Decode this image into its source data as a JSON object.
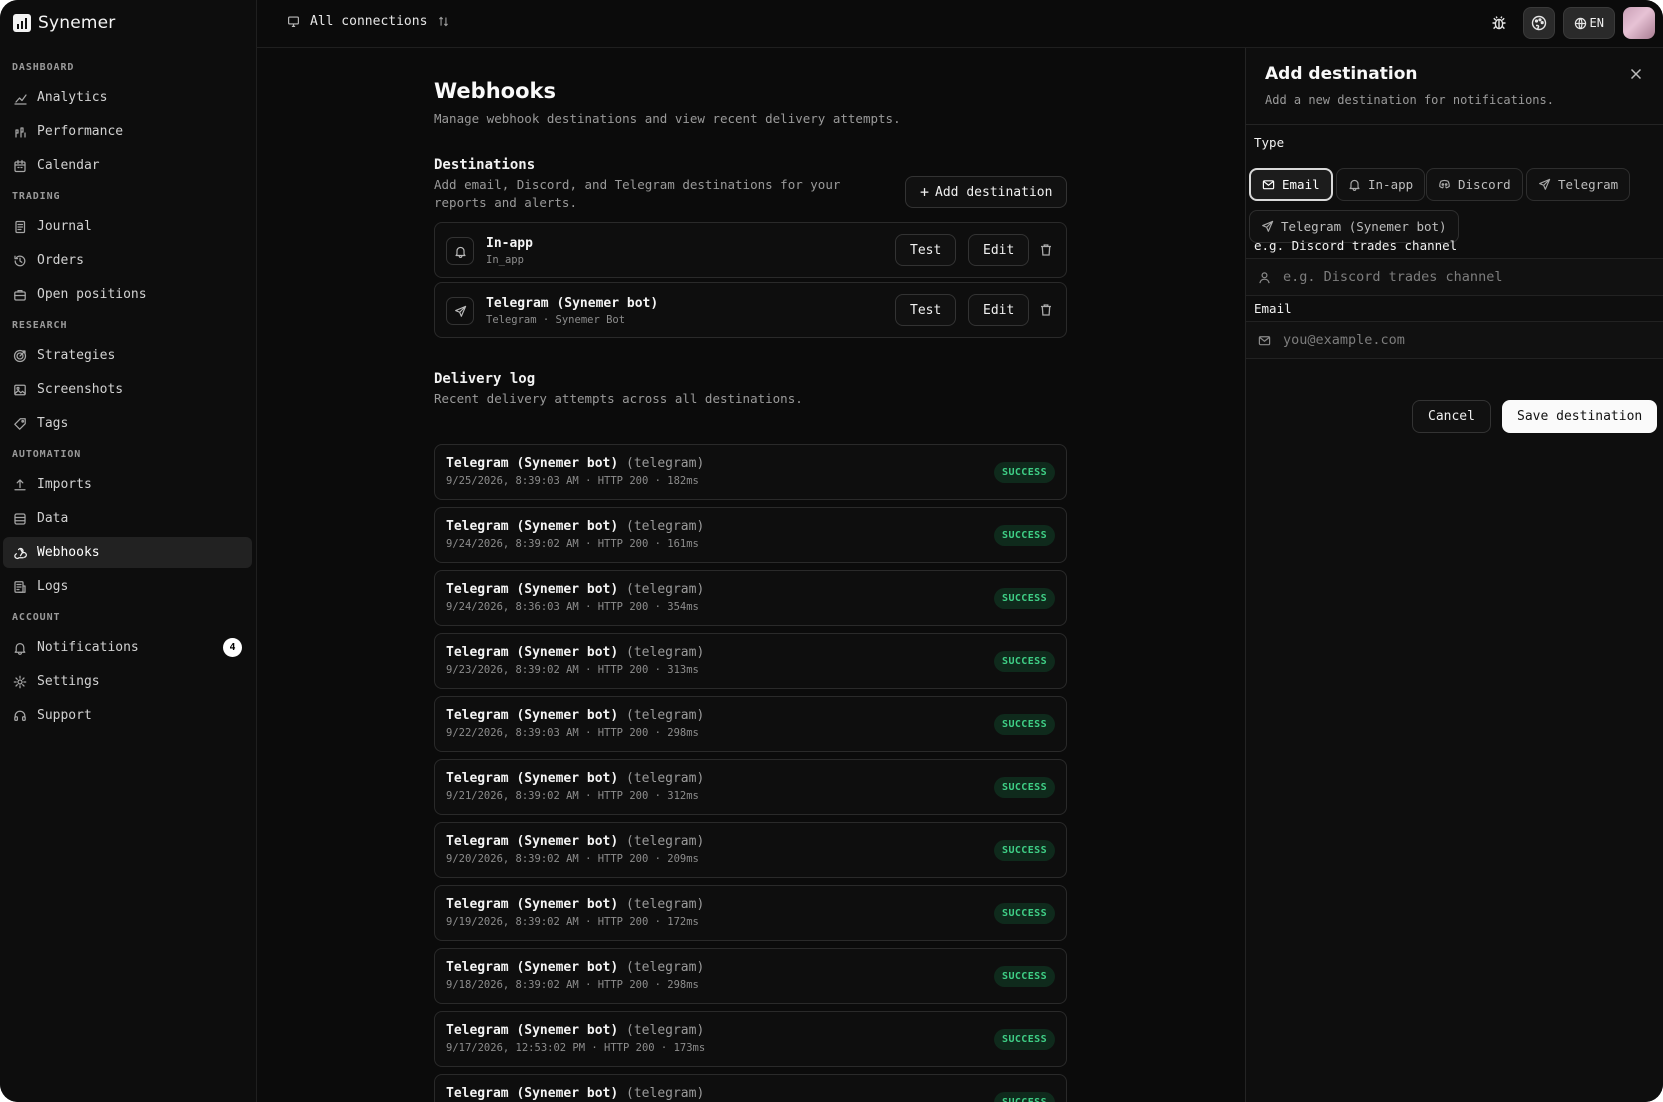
{
  "app": {
    "name": "Synemer"
  },
  "topbar": {
    "connection_label": "All connections",
    "lang": "EN"
  },
  "sidebar": {
    "sections": [
      {
        "label": "DASHBOARD",
        "items": [
          {
            "label": "Analytics",
            "icon": "chart-line-icon"
          },
          {
            "label": "Performance",
            "icon": "performance-icon"
          },
          {
            "label": "Calendar",
            "icon": "calendar-icon"
          }
        ]
      },
      {
        "label": "TRADING",
        "items": [
          {
            "label": "Journal",
            "icon": "journal-icon"
          },
          {
            "label": "Orders",
            "icon": "history-icon"
          },
          {
            "label": "Open positions",
            "icon": "briefcase-icon"
          }
        ]
      },
      {
        "label": "RESEARCH",
        "items": [
          {
            "label": "Strategies",
            "icon": "target-icon"
          },
          {
            "label": "Screenshots",
            "icon": "image-icon"
          },
          {
            "label": "Tags",
            "icon": "tag-icon"
          }
        ]
      },
      {
        "label": "AUTOMATION",
        "items": [
          {
            "label": "Imports",
            "icon": "upload-icon"
          },
          {
            "label": "Data",
            "icon": "database-icon"
          },
          {
            "label": "Webhooks",
            "icon": "webhook-icon",
            "active": true
          },
          {
            "label": "Logs",
            "icon": "logs-icon"
          }
        ]
      },
      {
        "label": "ACCOUNT",
        "items": [
          {
            "label": "Notifications",
            "icon": "bell-icon",
            "badge": "4"
          },
          {
            "label": "Settings",
            "icon": "gear-icon"
          },
          {
            "label": "Support",
            "icon": "headset-icon"
          }
        ]
      }
    ]
  },
  "main": {
    "title": "Webhooks",
    "subtitle": "Manage webhook destinations and view recent delivery attempts.",
    "destinations": {
      "title": "Destinations",
      "subtitle": "Add email, Discord, and Telegram destinations for your reports and alerts.",
      "add_label": "Add destination",
      "items": [
        {
          "name": "In-app",
          "meta": "In_app",
          "icon": "bell-icon",
          "test_label": "Test",
          "edit_label": "Edit"
        },
        {
          "name": "Telegram (Synemer bot)",
          "meta": "Telegram · Synemer Bot",
          "icon": "send-icon",
          "test_label": "Test",
          "edit_label": "Edit"
        }
      ]
    },
    "delivery_log": {
      "title": "Delivery log",
      "subtitle": "Recent delivery attempts across all destinations.",
      "rows": [
        {
          "name": "Telegram (Synemer bot)",
          "channel": "(telegram)",
          "meta": "9/25/2026, 8:39:03 AM · HTTP 200 · 182ms",
          "status": "SUCCESS"
        },
        {
          "name": "Telegram (Synemer bot)",
          "channel": "(telegram)",
          "meta": "9/24/2026, 8:39:02 AM · HTTP 200 · 161ms",
          "status": "SUCCESS"
        },
        {
          "name": "Telegram (Synemer bot)",
          "channel": "(telegram)",
          "meta": "9/24/2026, 8:36:03 AM · HTTP 200 · 354ms",
          "status": "SUCCESS"
        },
        {
          "name": "Telegram (Synemer bot)",
          "channel": "(telegram)",
          "meta": "9/23/2026, 8:39:02 AM · HTTP 200 · 313ms",
          "status": "SUCCESS"
        },
        {
          "name": "Telegram (Synemer bot)",
          "channel": "(telegram)",
          "meta": "9/22/2026, 8:39:03 AM · HTTP 200 · 298ms",
          "status": "SUCCESS"
        },
        {
          "name": "Telegram (Synemer bot)",
          "channel": "(telegram)",
          "meta": "9/21/2026, 8:39:02 AM · HTTP 200 · 312ms",
          "status": "SUCCESS"
        },
        {
          "name": "Telegram (Synemer bot)",
          "channel": "(telegram)",
          "meta": "9/20/2026, 8:39:02 AM · HTTP 200 · 209ms",
          "status": "SUCCESS"
        },
        {
          "name": "Telegram (Synemer bot)",
          "channel": "(telegram)",
          "meta": "9/19/2026, 8:39:02 AM · HTTP 200 · 172ms",
          "status": "SUCCESS"
        },
        {
          "name": "Telegram (Synemer bot)",
          "channel": "(telegram)",
          "meta": "9/18/2026, 8:39:02 AM · HTTP 200 · 298ms",
          "status": "SUCCESS"
        },
        {
          "name": "Telegram (Synemer bot)",
          "channel": "(telegram)",
          "meta": "9/17/2026, 12:53:02 PM · HTTP 200 · 173ms",
          "status": "SUCCESS"
        },
        {
          "name": "Telegram (Synemer bot)",
          "channel": "(telegram)",
          "meta": "",
          "status": "SUCCESS"
        }
      ]
    }
  },
  "drawer": {
    "title": "Add destination",
    "subtitle": "Add a new destination for notifications.",
    "type_label": "Type",
    "types": [
      {
        "label": "Email",
        "icon": "mail-icon",
        "selected": true
      },
      {
        "label": "In-app",
        "icon": "bell-icon"
      },
      {
        "label": "Discord",
        "icon": "discord-icon"
      },
      {
        "label": "Telegram",
        "icon": "send-icon"
      },
      {
        "label": "Telegram (Synemer bot)",
        "icon": "send-icon"
      }
    ],
    "name_label": "e.g. Discord trades channel",
    "name_placeholder": "e.g. Discord trades channel",
    "email_label": "Email",
    "email_placeholder": "you@example.com",
    "cancel_label": "Cancel",
    "save_label": "Save destination"
  },
  "colors": {
    "background": "#0b0b0b",
    "success": "#3fcf86",
    "success_bg": "#0f2a1c"
  }
}
